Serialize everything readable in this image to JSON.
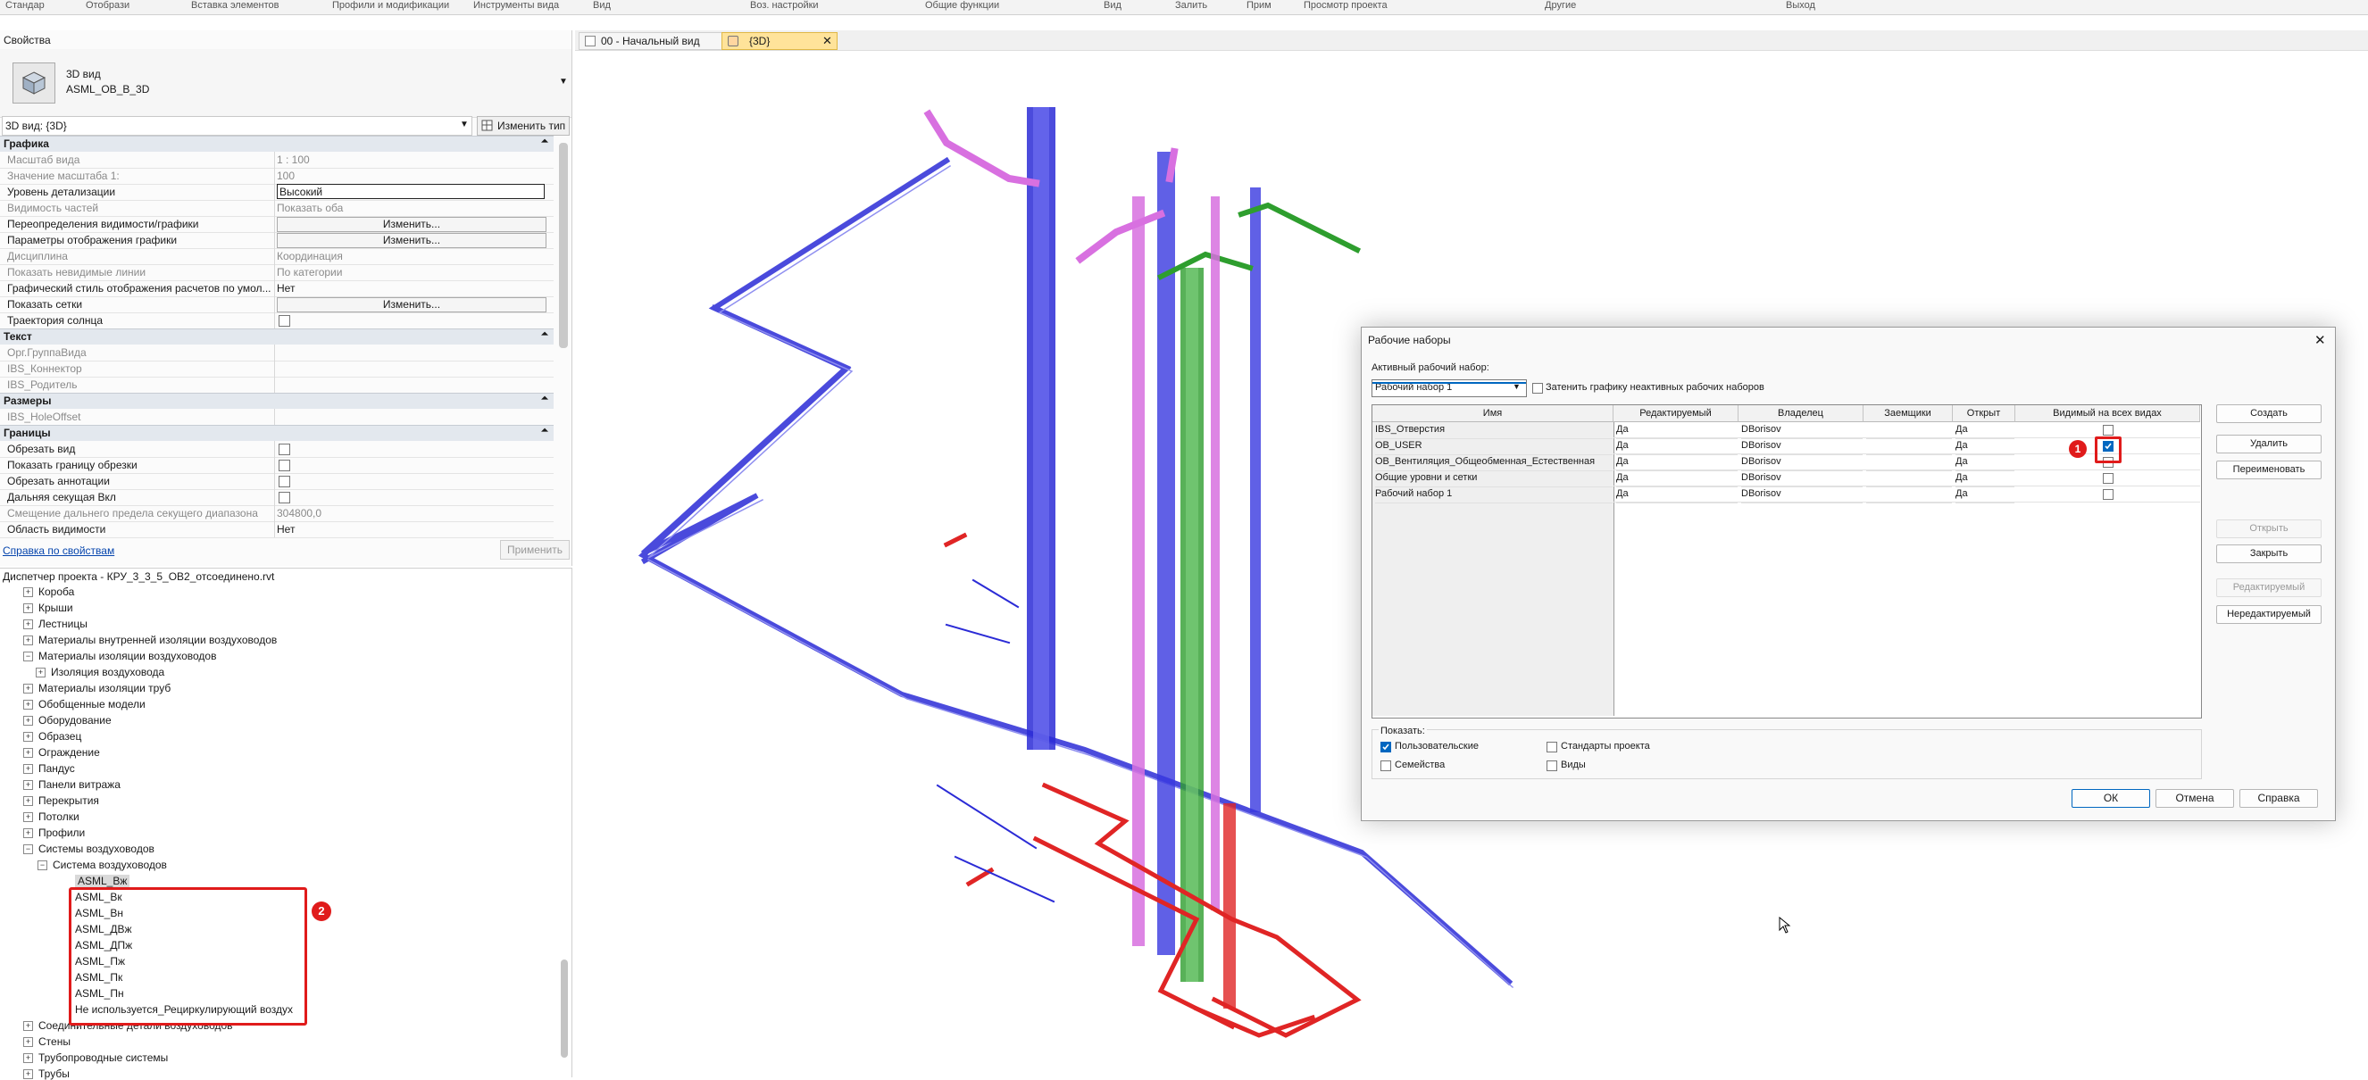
{
  "ribbon": {
    "items": [
      "Стандар",
      "Отобрази",
      "Вставка элементов",
      "Профили и модификации",
      "Инструменты вида",
      "Вид",
      "Воз. настройки",
      "Общие функции",
      "Вид",
      "Залить",
      "Прим",
      "Просмотр проекта",
      "Другие",
      "Выход"
    ]
  },
  "properties": {
    "title": "Свойства",
    "type_name_1": "3D вид",
    "type_name_2": "ASML_OB_B_3D",
    "view_selector": "3D вид: {3D}",
    "edit_type": "Изменить тип",
    "sections": {
      "graphics": "Графика",
      "text": "Текст",
      "dimensions": "Размеры",
      "extents": "Границы"
    },
    "rows": {
      "view_scale": {
        "k": "Масштаб вида",
        "v": "1 : 100"
      },
      "scale_value": {
        "k": "Значение масштаба    1:",
        "v": "100"
      },
      "detail_level": {
        "k": "Уровень детализации",
        "v": "Высокий"
      },
      "parts_visibility": {
        "k": "Видимость частей",
        "v": "Показать оба"
      },
      "vg_overrides": {
        "k": "Переопределения видимости/графики",
        "v": "Изменить..."
      },
      "display_options": {
        "k": "Параметры отображения графики",
        "v": "Изменить..."
      },
      "discipline": {
        "k": "Дисциплина",
        "v": "Координация"
      },
      "hidden_lines": {
        "k": "Показать невидимые линии",
        "v": "По категории"
      },
      "calc_style": {
        "k": "Графический стиль отображения расчетов по умол...",
        "v": "Нет"
      },
      "show_grids": {
        "k": "Показать сетки",
        "v": "Изменить..."
      },
      "sun_path": {
        "k": "Траектория солнца",
        "v": ""
      },
      "org_group": {
        "k": "Орг.ГруппаВида",
        "v": ""
      },
      "ibs_connector": {
        "k": "IBS_Коннектор",
        "v": ""
      },
      "ibs_parent": {
        "k": "IBS_Родитель",
        "v": ""
      },
      "ibs_hole": {
        "k": "IBS_HoleOffset",
        "v": ""
      },
      "crop_view": {
        "k": "Обрезать вид",
        "v": ""
      },
      "crop_region": {
        "k": "Показать границу обрезки",
        "v": ""
      },
      "crop_annot": {
        "k": "Обрезать аннотации",
        "v": ""
      },
      "far_clip": {
        "k": "Дальняя секущая Вкл",
        "v": ""
      },
      "far_offset": {
        "k": "Смещение дальнего предела секущего диапазона",
        "v": "304800,0"
      },
      "scope_box": {
        "k": "Область видимости",
        "v": "Нет"
      }
    },
    "help_link": "Справка по свойствам",
    "apply": "Применить"
  },
  "browser": {
    "title": "Диспетчер проекта - КРУ_3_3_5_ОВ2_отсоединено.rvt",
    "items": [
      {
        "sign": "+",
        "label": "Короба"
      },
      {
        "sign": "+",
        "label": "Крыши"
      },
      {
        "sign": "+",
        "label": "Лестницы"
      },
      {
        "sign": "+",
        "label": "Материалы внутренней изоляции воздуховодов"
      },
      {
        "sign": "−",
        "label": "Материалы изоляции воздуховодов"
      },
      {
        "sign": "+",
        "label": "Изоляция воздуховода"
      },
      {
        "sign": "+",
        "label": "Материалы изоляции труб"
      },
      {
        "sign": "+",
        "label": "Обобщенные модели"
      },
      {
        "sign": "+",
        "label": "Оборудование"
      },
      {
        "sign": "+",
        "label": "Образец"
      },
      {
        "sign": "+",
        "label": "Ограждение"
      },
      {
        "sign": "+",
        "label": "Пандус"
      },
      {
        "sign": "+",
        "label": "Панели витража"
      },
      {
        "sign": "+",
        "label": "Перекрытия"
      },
      {
        "sign": "+",
        "label": "Потолки"
      },
      {
        "sign": "+",
        "label": "Профили"
      },
      {
        "sign": "−",
        "label": "Системы воздуховодов"
      },
      {
        "sign": "−",
        "label": "Система воздуховодов"
      },
      {
        "sign": "",
        "label": "ASML_Вж"
      },
      {
        "sign": "",
        "label": "ASML_Вк"
      },
      {
        "sign": "",
        "label": "ASML_Вн"
      },
      {
        "sign": "",
        "label": "ASML_ДВж"
      },
      {
        "sign": "",
        "label": "ASML_ДПж"
      },
      {
        "sign": "",
        "label": "ASML_Пж"
      },
      {
        "sign": "",
        "label": "ASML_Пк"
      },
      {
        "sign": "",
        "label": "ASML_Пн"
      },
      {
        "sign": "",
        "label": "Не используется_Рециркулирующий воздух"
      },
      {
        "sign": "+",
        "label": "Соединительные детали воздуховодов"
      },
      {
        "sign": "+",
        "label": "Стены"
      },
      {
        "sign": "+",
        "label": "Трубопроводные системы"
      },
      {
        "sign": "+",
        "label": "Трубы"
      }
    ],
    "badge": "2"
  },
  "tabs": [
    {
      "label": "00 - Начальный вид"
    },
    {
      "label": "{3D}",
      "close": "✕"
    }
  ],
  "dialog": {
    "title": "Рабочие наборы",
    "close": "✕",
    "active_label": "Активный рабочий набор:",
    "active_value": "Рабочий набор 1",
    "dim_label": "Затенить графику неактивных рабочих наборов",
    "columns": [
      "Имя",
      "Редактируемый",
      "Владелец",
      "Заемщики",
      "Открыт",
      "Видимый на всех видах"
    ],
    "rows": [
      {
        "name": "IBS_Отверстия",
        "editable": "Да",
        "owner": "DBorisov",
        "borrowers": "",
        "open": "Да",
        "visible": false
      },
      {
        "name": "OB_USER",
        "editable": "Да",
        "owner": "DBorisov",
        "borrowers": "",
        "open": "Да",
        "visible": true
      },
      {
        "name": "OB_Вентиляция_Общеобменная_Естественная",
        "editable": "Да",
        "owner": "DBorisov",
        "borrowers": "",
        "open": "Да",
        "visible": false
      },
      {
        "name": "Общие уровни и сетки",
        "editable": "Да",
        "owner": "DBorisov",
        "borrowers": "",
        "open": "Да",
        "visible": false
      },
      {
        "name": "Рабочий набор 1",
        "editable": "Да",
        "owner": "DBorisov",
        "borrowers": "",
        "open": "Да",
        "visible": false
      }
    ],
    "badge": "1",
    "buttons": {
      "create": "Создать",
      "delete": "Удалить",
      "rename": "Переименовать",
      "open": "Открыть",
      "close": "Закрыть",
      "editable": "Редактируемый",
      "noneditable": "Нередактируемый"
    },
    "show": {
      "label": "Показать:",
      "user": "Пользовательские",
      "families": "Семейства",
      "standards": "Стандарты проекта",
      "views": "Виды"
    },
    "ok": "ОК",
    "cancel": "Отмена",
    "help": "Справка"
  },
  "colors": {
    "accent": "#0067c0",
    "highlight": "#e01b1b",
    "blue_duct": "#2b2bd6",
    "magenta_duct": "#d870e0",
    "green_duct": "#2e9e2e",
    "red_duct": "#e02525"
  }
}
